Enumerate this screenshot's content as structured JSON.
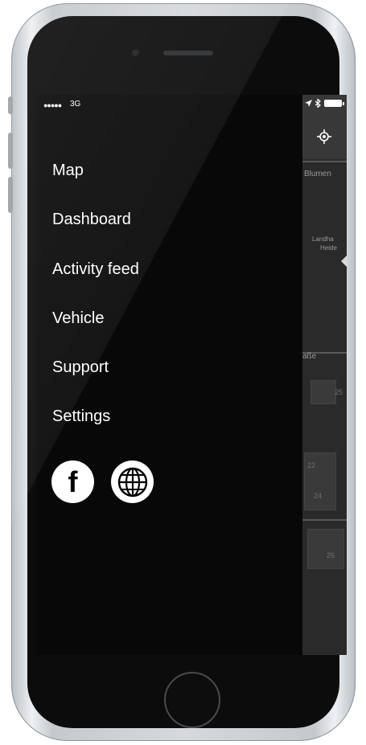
{
  "status_bar": {
    "signal": "●●●●●",
    "carrier": "3G"
  },
  "menu": {
    "items": [
      {
        "label": "Map"
      },
      {
        "label": "Dashboard"
      },
      {
        "label": "Activity feed"
      },
      {
        "label": "Vehicle"
      },
      {
        "label": "Support"
      },
      {
        "label": "Settings"
      }
    ]
  },
  "social": {
    "facebook_glyph": "f",
    "icons": [
      "facebook-icon",
      "globe-icon"
    ]
  },
  "map_peek": {
    "street_top": "Blumen",
    "area_line1": "Landha",
    "area_line2": "Heide",
    "street_mid": "aße",
    "house_numbers": [
      "25",
      "22",
      "24",
      "26"
    ]
  },
  "colors": {
    "drawer_bg": "#080809",
    "menu_text": "#ffffff",
    "map_bg": "#2a2a2a"
  }
}
